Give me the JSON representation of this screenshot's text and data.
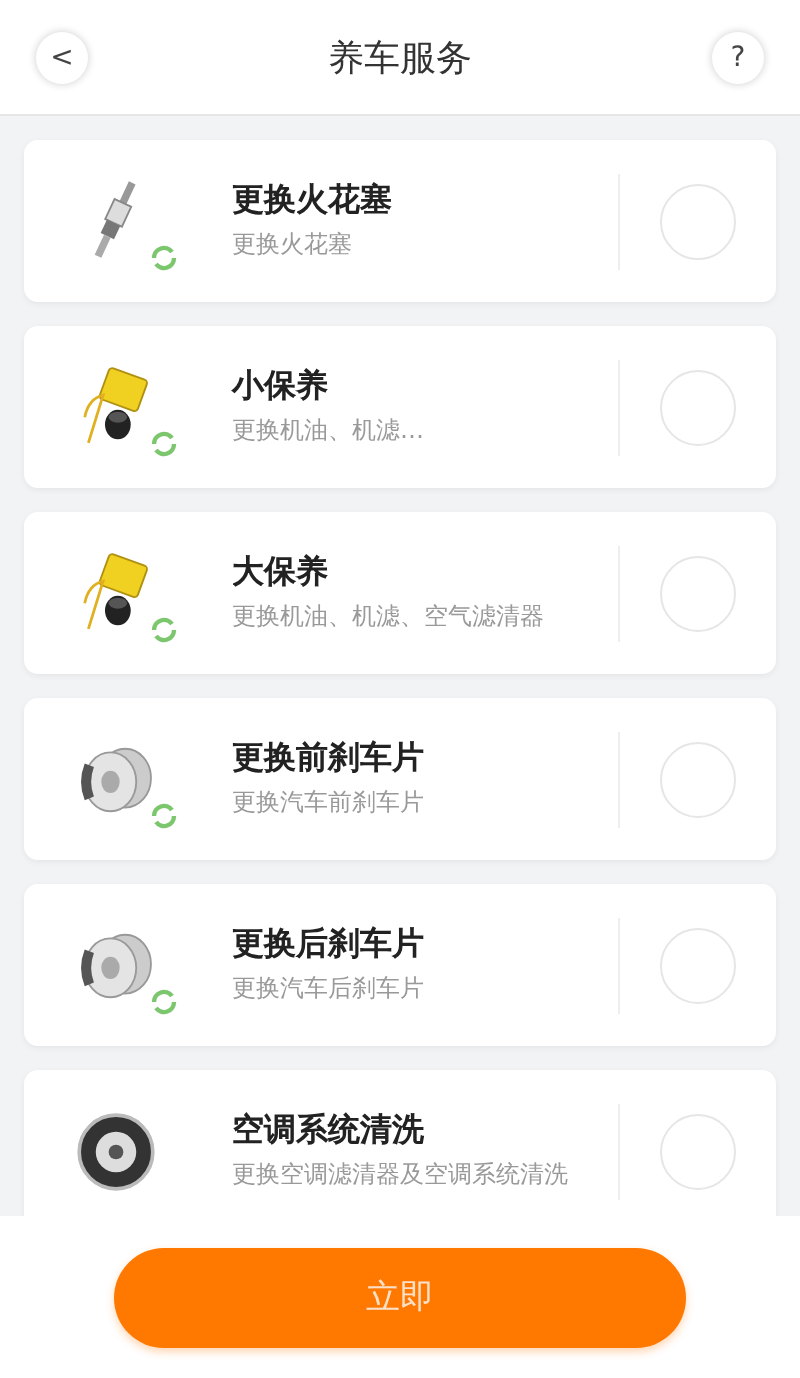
{
  "header": {
    "back": "<",
    "title": "养车服务",
    "help": "?"
  },
  "services": [
    {
      "kind": "spark_plug",
      "name": "更换火花塞",
      "description": "更换火花塞",
      "refresh_badge": true,
      "selected": false
    },
    {
      "kind": "oil",
      "name": "小保养",
      "description": "更换机油、机滤…",
      "refresh_badge": true,
      "selected": false
    },
    {
      "kind": "oil",
      "name": "大保养",
      "description": "更换机油、机滤、空气滤清器",
      "refresh_badge": true,
      "selected": false
    },
    {
      "kind": "brake",
      "name": "更换前刹车片",
      "description": "更换汽车前刹车片",
      "refresh_badge": true,
      "selected": false
    },
    {
      "kind": "brake",
      "name": "更换后刹车片",
      "description": "更换汽车后刹车片",
      "refresh_badge": true,
      "selected": false
    },
    {
      "kind": "ac",
      "name": "空调系统清洗",
      "description": "更换空调滤清器及空调系统清洗",
      "refresh_badge": false,
      "selected": false
    }
  ],
  "submit_button": "立即"
}
